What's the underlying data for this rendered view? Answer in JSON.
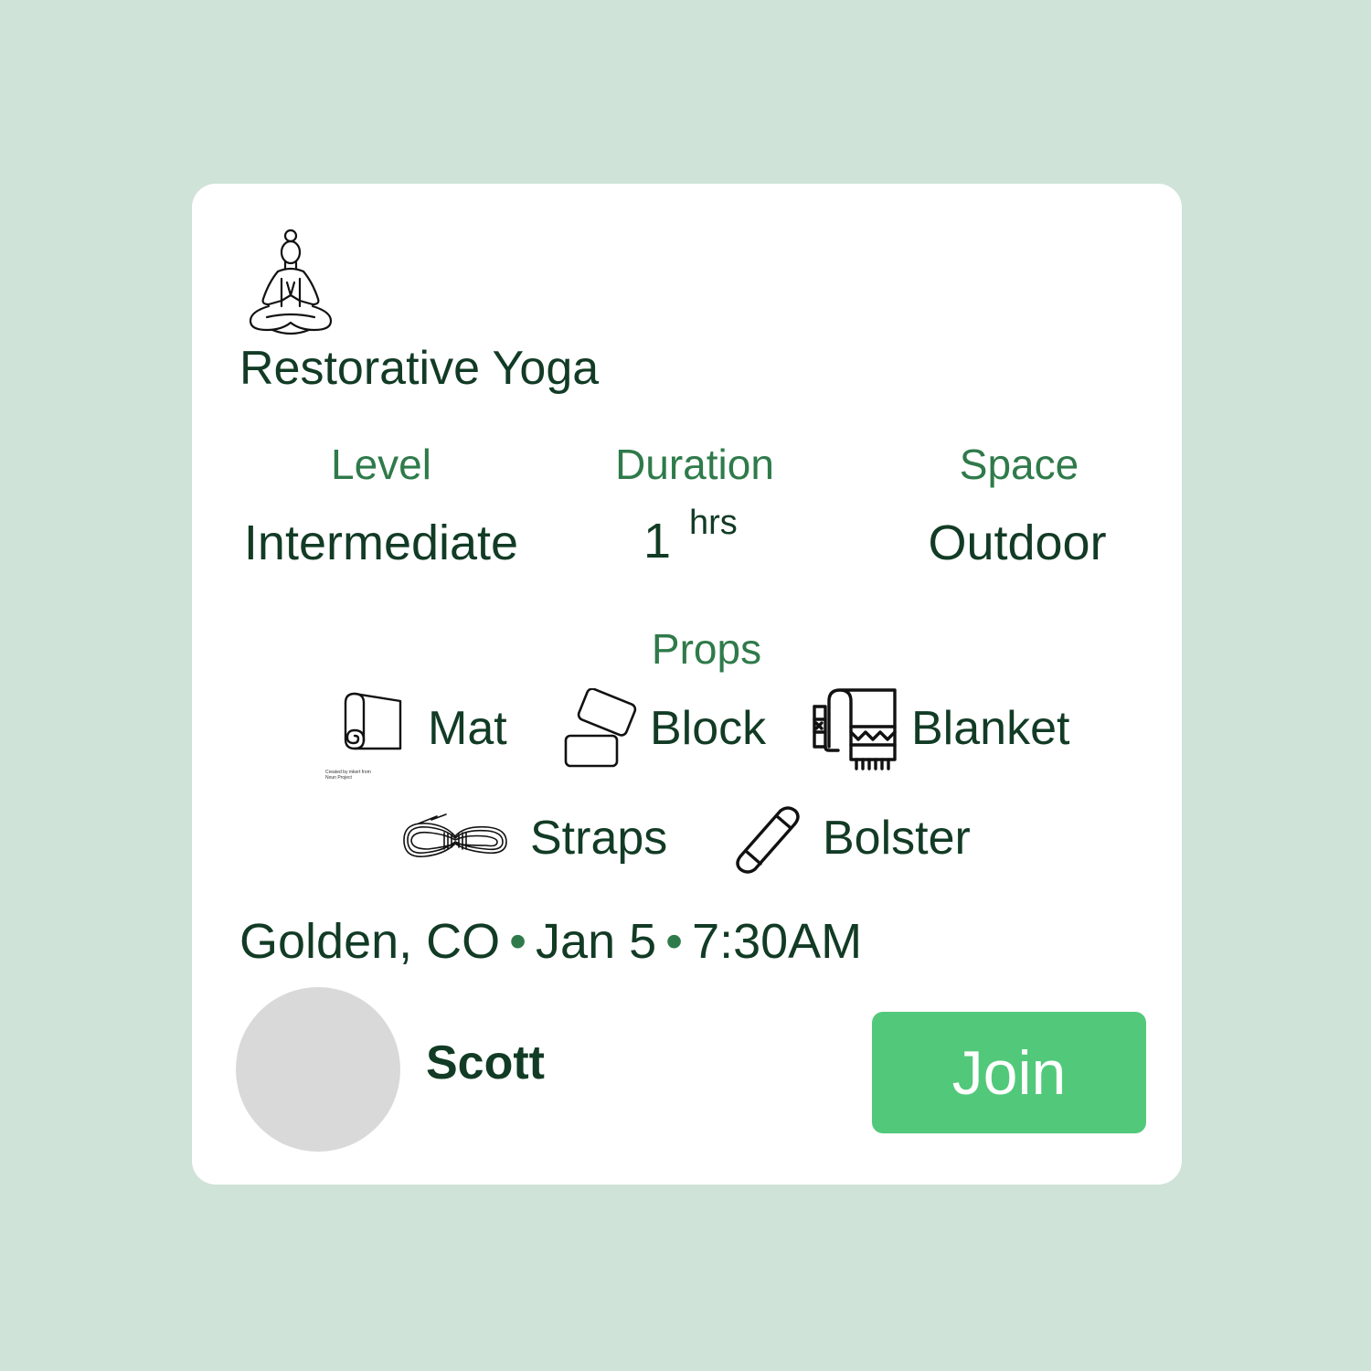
{
  "class": {
    "title": "Restorative Yoga",
    "icon": "meditation-pose-icon"
  },
  "stats": {
    "level": {
      "label": "Level",
      "value": "Intermediate"
    },
    "duration": {
      "label": "Duration",
      "value": "1",
      "unit": "hrs"
    },
    "space": {
      "label": "Space",
      "value": "Outdoor"
    }
  },
  "props": {
    "label": "Props",
    "items": [
      {
        "label": "Mat",
        "icon": "yoga-mat-icon"
      },
      {
        "label": "Block",
        "icon": "yoga-block-icon"
      },
      {
        "label": "Blanket",
        "icon": "blanket-icon"
      },
      {
        "label": "Straps",
        "icon": "strap-icon"
      },
      {
        "label": "Bolster",
        "icon": "bolster-icon"
      }
    ],
    "mat_credit": "Created by mkert from Noun Project"
  },
  "session": {
    "location": "Golden, CO",
    "date": "Jan 5",
    "time": "7:30AM",
    "separator": "•"
  },
  "host": {
    "name": "Scott"
  },
  "actions": {
    "join_label": "Join"
  },
  "colors": {
    "background": "#cfe3d8",
    "card": "#ffffff",
    "text_dark": "#123b25",
    "label_green": "#2f7a4a",
    "button_green": "#52c97a",
    "avatar_gray": "#d9d9d9"
  }
}
